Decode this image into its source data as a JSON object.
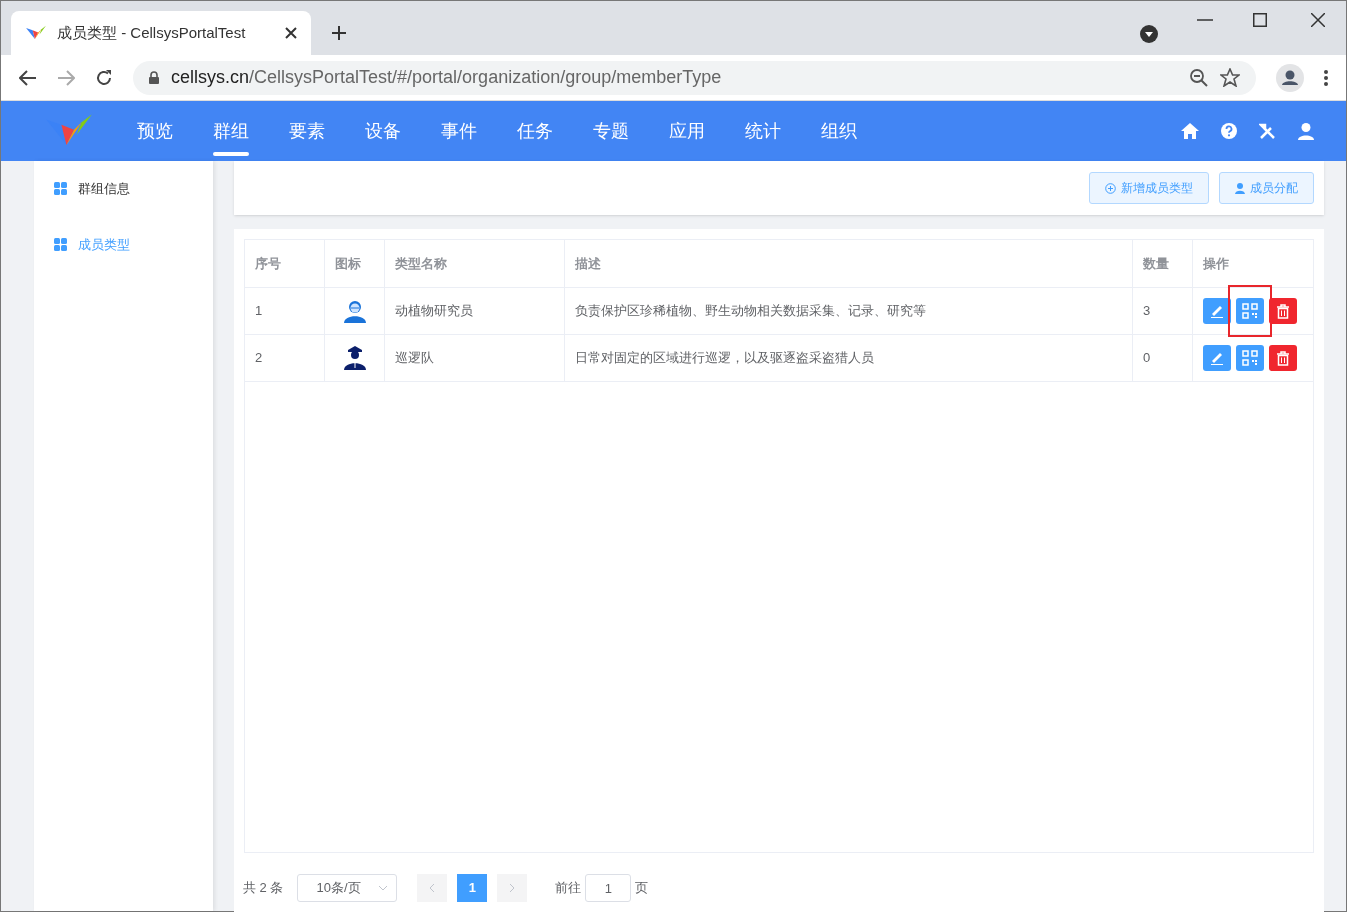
{
  "browser": {
    "tab_title": "成员类型 - CellsysPortalTest",
    "url_host": "cellsys.cn",
    "url_path": "/CellsysPortalTest/#/portal/organization/group/memberType"
  },
  "nav": {
    "items": [
      {
        "label": "预览",
        "selected": false
      },
      {
        "label": "群组",
        "selected": true
      },
      {
        "label": "要素",
        "selected": false
      },
      {
        "label": "设备",
        "selected": false
      },
      {
        "label": "事件",
        "selected": false
      },
      {
        "label": "任务",
        "selected": false
      },
      {
        "label": "专题",
        "selected": false
      },
      {
        "label": "应用",
        "selected": false
      },
      {
        "label": "统计",
        "selected": false
      },
      {
        "label": "组织",
        "selected": false
      }
    ]
  },
  "sidebar": {
    "items": [
      {
        "label": "群组信息",
        "selected": false
      },
      {
        "label": "成员类型",
        "selected": true
      }
    ]
  },
  "toolbar": {
    "buttons": [
      {
        "kind": "add",
        "label": "新增成员类型"
      },
      {
        "kind": "assign",
        "label": "成员分配"
      }
    ]
  },
  "table": {
    "columns": [
      "序号",
      "图标",
      "类型名称",
      "描述",
      "数量",
      "操作"
    ],
    "rows": [
      {
        "index": "1",
        "kind": "researcher",
        "name": "动植物研究员",
        "description": "负责保护区珍稀植物、野生动物相关数据采集、记录、研究等",
        "count": "3",
        "qr_highlighted": true
      },
      {
        "index": "2",
        "kind": "guard",
        "name": "巡逻队",
        "description": "日常对固定的区域进行巡逻，以及驱逐盗采盗猎人员",
        "count": "0",
        "qr_highlighted": false
      }
    ]
  },
  "pagination": {
    "total": "共 2 条",
    "page_size": "10条/页",
    "pages": [
      {
        "label": "1",
        "selected": true
      }
    ],
    "goto_label": "前往",
    "goto_value": "1",
    "goto_suffix": "页"
  }
}
